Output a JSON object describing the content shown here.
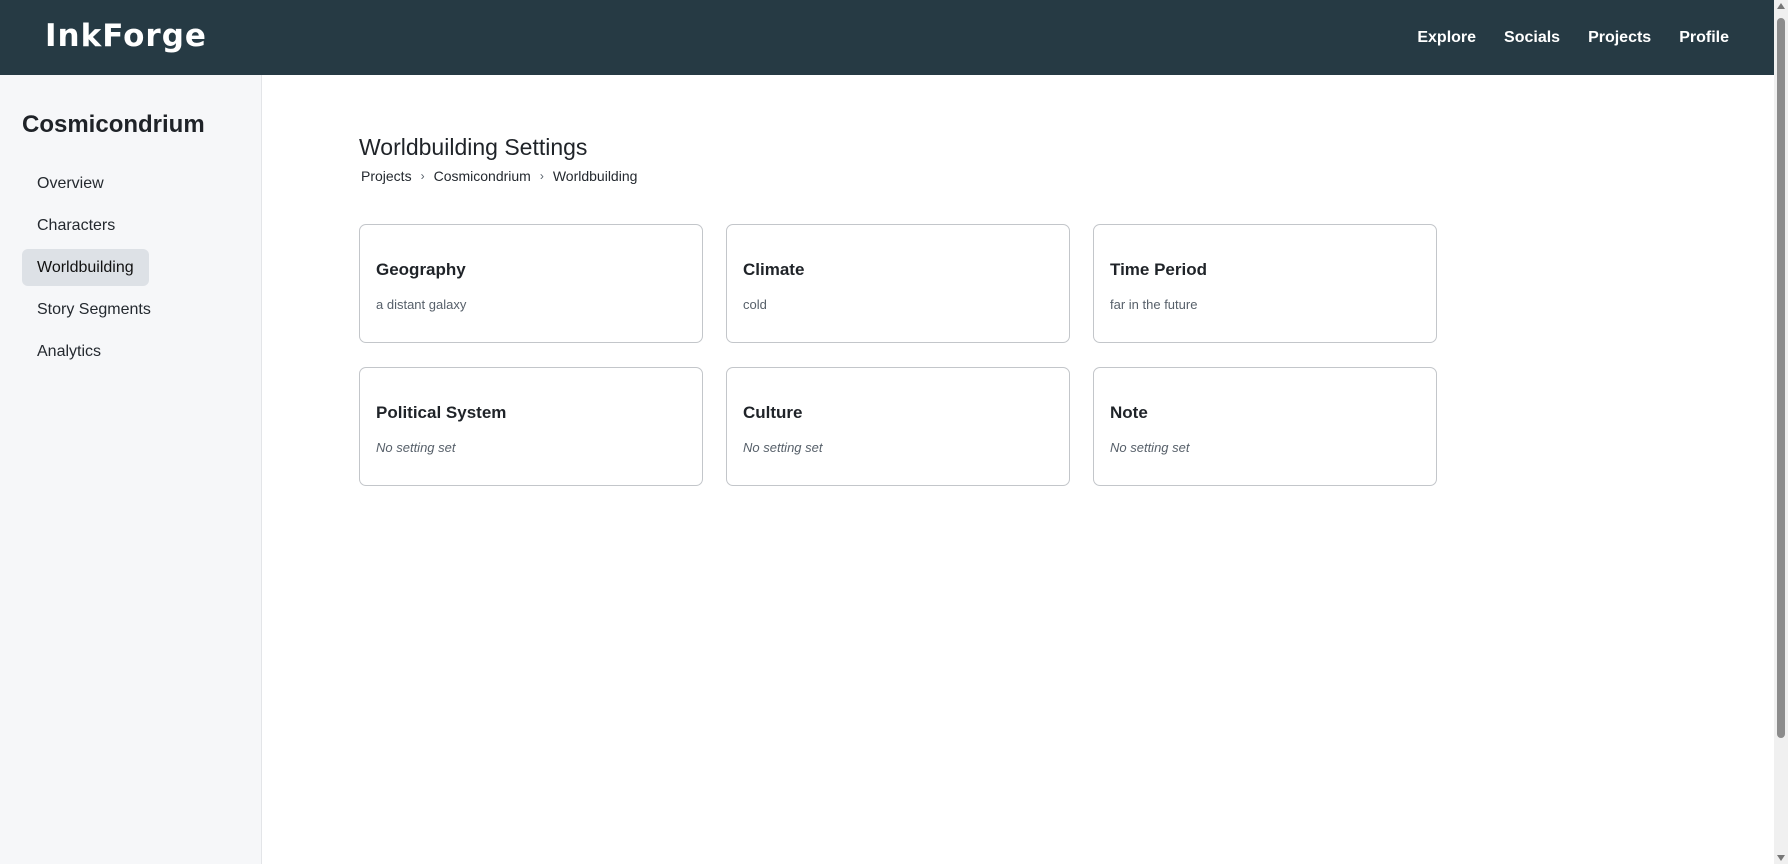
{
  "header": {
    "logo": "InkForge",
    "nav": [
      "Explore",
      "Socials",
      "Projects",
      "Profile"
    ]
  },
  "sidebar": {
    "project_title": "Cosmicondrium",
    "items": [
      {
        "label": "Overview"
      },
      {
        "label": "Characters"
      },
      {
        "label": "Worldbuilding",
        "active": true
      },
      {
        "label": "Story Segments"
      },
      {
        "label": "Analytics"
      }
    ]
  },
  "main": {
    "title": "Worldbuilding Settings",
    "breadcrumb": [
      "Projects",
      "Cosmicondrium",
      "Worldbuilding"
    ],
    "breadcrumb_separator": "›",
    "cards": [
      {
        "title": "Geography",
        "value": "a distant galaxy"
      },
      {
        "title": "Climate",
        "value": "cold"
      },
      {
        "title": "Time Period",
        "value": "far in the future"
      },
      {
        "title": "Political System",
        "value": "No setting set"
      },
      {
        "title": "Culture",
        "value": "No setting set"
      },
      {
        "title": "Note",
        "value": "No setting set"
      }
    ]
  },
  "colors": {
    "header_bg": "#263a44",
    "sidebar_bg": "#f6f7f9",
    "active_item_bg": "#dde1e6",
    "card_border": "#c3c6ca"
  }
}
